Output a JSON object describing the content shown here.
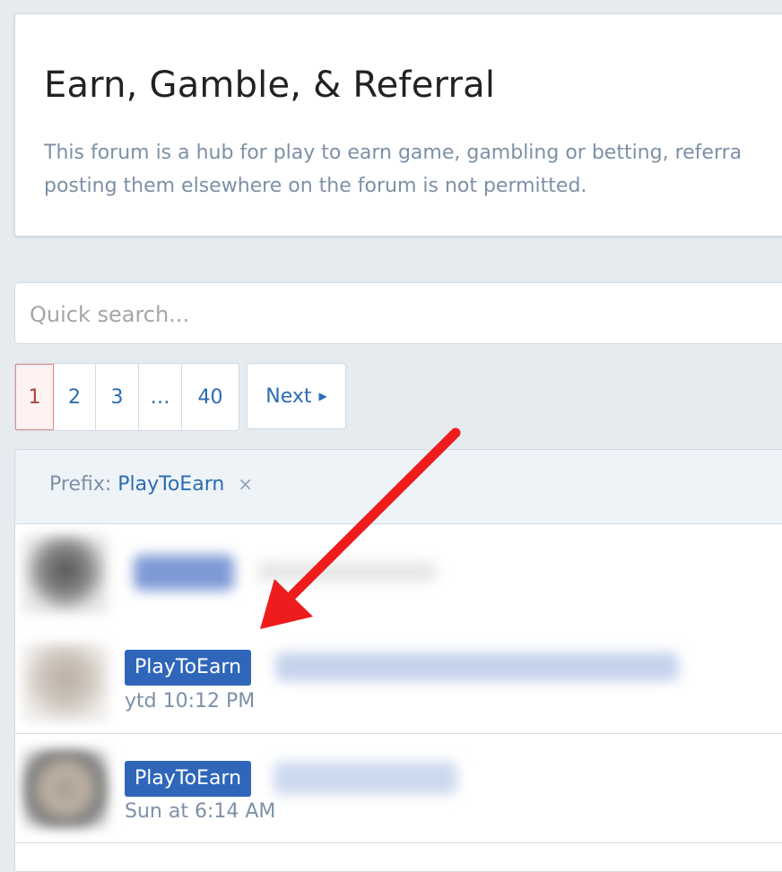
{
  "forum": {
    "title": "Earn, Gamble, & Referral",
    "description_line1": "This forum is a hub for play to earn game, gambling or betting, referra",
    "description_line2": "posting them elsewhere on the forum is not permitted."
  },
  "search": {
    "placeholder": "Quick search..."
  },
  "pagination": {
    "pages": [
      "1",
      "2",
      "3",
      "…",
      "40"
    ],
    "current": "1",
    "next_label": "Next"
  },
  "filter": {
    "label": "Prefix:",
    "value": "PlayToEarn",
    "remove_icon": "×"
  },
  "threads": [
    {
      "prefix": "",
      "time": ""
    },
    {
      "prefix": "PlayToEarn",
      "time": "ytd 10:12 PM"
    },
    {
      "prefix": "PlayToEarn",
      "time": "Sun at 6:14 AM"
    }
  ],
  "colors": {
    "accent": "#2b6cb0",
    "prefix_bg": "#2f66b9",
    "current_page": "#a94442",
    "annotation_arrow": "#ee1c1c"
  }
}
